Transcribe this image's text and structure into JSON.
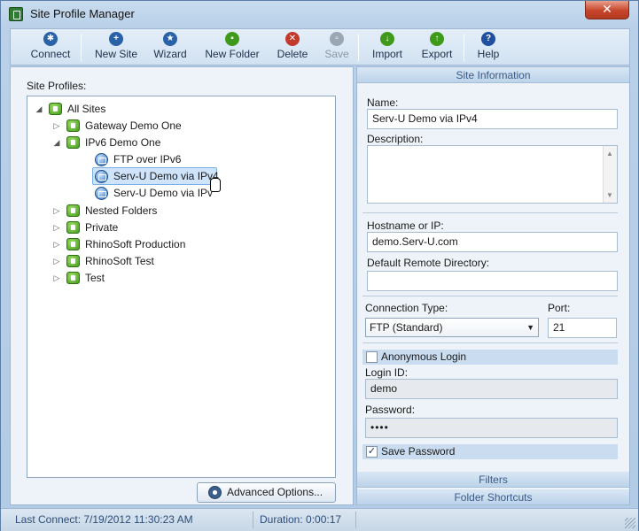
{
  "window": {
    "title": "Site Profile Manager",
    "close_icon": "close-icon"
  },
  "toolbar": {
    "buttons": [
      {
        "label": "Connect",
        "icon": "connect-icon",
        "enabled": true,
        "color": "#2a62a8"
      },
      {
        "label": "New Site",
        "icon": "new-site-icon",
        "enabled": true,
        "color": "#2a62a8"
      },
      {
        "label": "Wizard",
        "icon": "wizard-icon",
        "enabled": true,
        "color": "#2a62a8"
      },
      {
        "label": "New Folder",
        "icon": "new-folder-icon",
        "enabled": true,
        "color": "#3f9a1c"
      },
      {
        "label": "Delete",
        "icon": "delete-icon",
        "enabled": true,
        "color": "#c33a2c"
      },
      {
        "label": "Save",
        "icon": "save-icon",
        "enabled": false,
        "color": "#9aa7b5"
      },
      {
        "label": "Import",
        "icon": "import-icon",
        "enabled": true,
        "color": "#3f9a1c"
      },
      {
        "label": "Export",
        "icon": "export-icon",
        "enabled": true,
        "color": "#3f9a1c"
      },
      {
        "label": "Help",
        "icon": "help-icon",
        "enabled": true,
        "color": "#1f4f9e"
      }
    ]
  },
  "left": {
    "profiles_label": "Site Profiles:",
    "tree": [
      {
        "label": "All Sites",
        "type": "folder",
        "expanded": true
      },
      {
        "label": "Gateway Demo One",
        "type": "folder",
        "expanded": false
      },
      {
        "label": "IPv6 Demo One",
        "type": "folder",
        "expanded": true
      },
      {
        "label": "FTP over IPv6",
        "type": "site"
      },
      {
        "label": "Serv-U Demo via IPv4",
        "type": "site",
        "selected": true
      },
      {
        "label": "Serv-U Demo via IPv",
        "type": "site"
      },
      {
        "label": "Nested Folders",
        "type": "folder",
        "expanded": false
      },
      {
        "label": "Private",
        "type": "folder",
        "expanded": false
      },
      {
        "label": "RhinoSoft Production",
        "type": "folder",
        "expanded": false
      },
      {
        "label": "RhinoSoft Test",
        "type": "folder",
        "expanded": false
      },
      {
        "label": "Test",
        "type": "folder",
        "expanded": false
      }
    ],
    "advanced_button": "Advanced Options..."
  },
  "right": {
    "site_info_header": "Site Information",
    "name_label": "Name:",
    "name_value": "Serv-U Demo via IPv4",
    "description_label": "Description:",
    "description_value": "",
    "hostname_label": "Hostname or IP:",
    "hostname_value": "demo.Serv-U.com",
    "remote_dir_label": "Default Remote Directory:",
    "remote_dir_value": "",
    "conn_type_label": "Connection Type:",
    "conn_type_value": "FTP (Standard)",
    "port_label": "Port:",
    "port_value": "21",
    "anonymous_label": "Anonymous Login",
    "anonymous_checked": false,
    "login_id_label": "Login ID:",
    "login_id_value": "demo",
    "password_label": "Password:",
    "password_value": "••••",
    "save_password_label": "Save Password",
    "save_password_checked": true,
    "filters_header": "Filters",
    "folder_shortcuts_header": "Folder Shortcuts"
  },
  "status": {
    "last_connect": "Last Connect: 7/19/2012 11:30:23 AM",
    "duration": "Duration: 0:00:17"
  }
}
